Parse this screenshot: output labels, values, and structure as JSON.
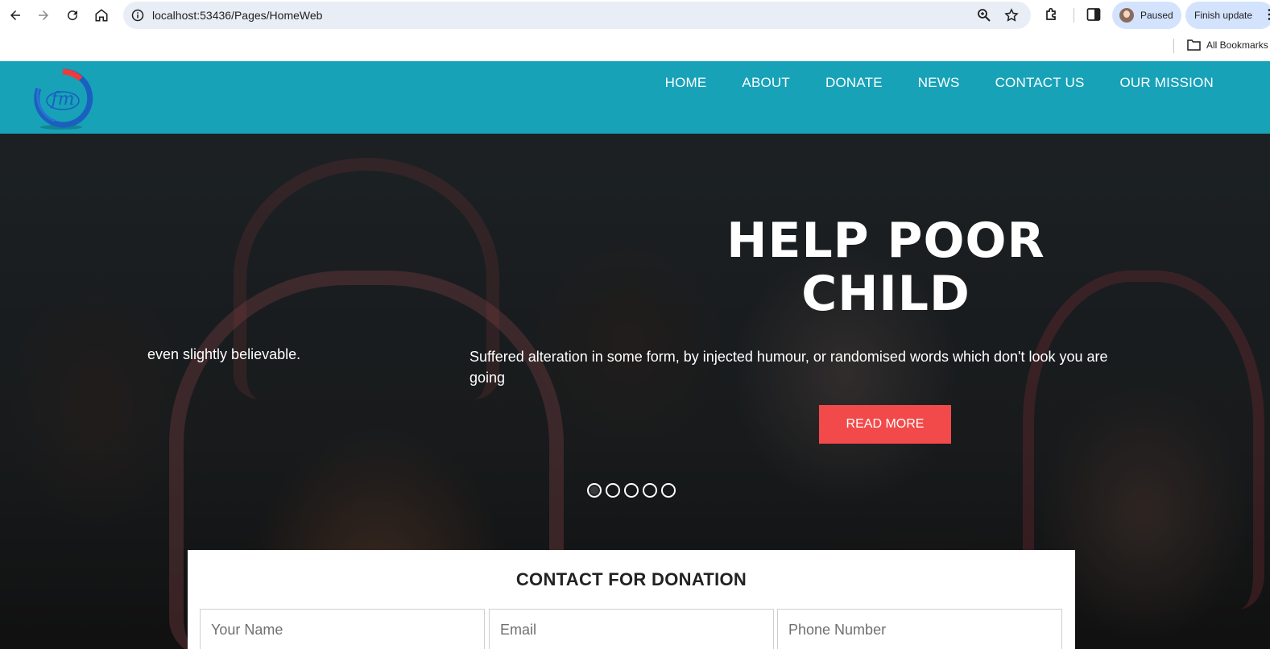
{
  "browser": {
    "url": "localhost:53436/Pages/HomeWeb",
    "profile_status": "Paused",
    "update_label": "Finish update",
    "all_bookmarks": "All Bookmarks"
  },
  "site": {
    "nav": [
      "HOME",
      "ABOUT",
      "DONATE",
      "NEWS",
      "CONTACT US",
      "OUR MISSION"
    ],
    "brand_color": "#17a2b8",
    "accent_color": "#f24a4a"
  },
  "hero": {
    "title_line1": "HELP POOR",
    "title_line2": "CHILD",
    "prev_text": "even slightly believable.",
    "text": "Suffered alteration in some form, by injected humour, or randomised words which don't look you are going",
    "button": "READ MORE",
    "slides": 5,
    "active_slide": 1
  },
  "donation": {
    "title": "CONTACT FOR DONATION",
    "name_placeholder": "Your Name",
    "email_placeholder": "Email",
    "phone_placeholder": "Phone Number"
  }
}
